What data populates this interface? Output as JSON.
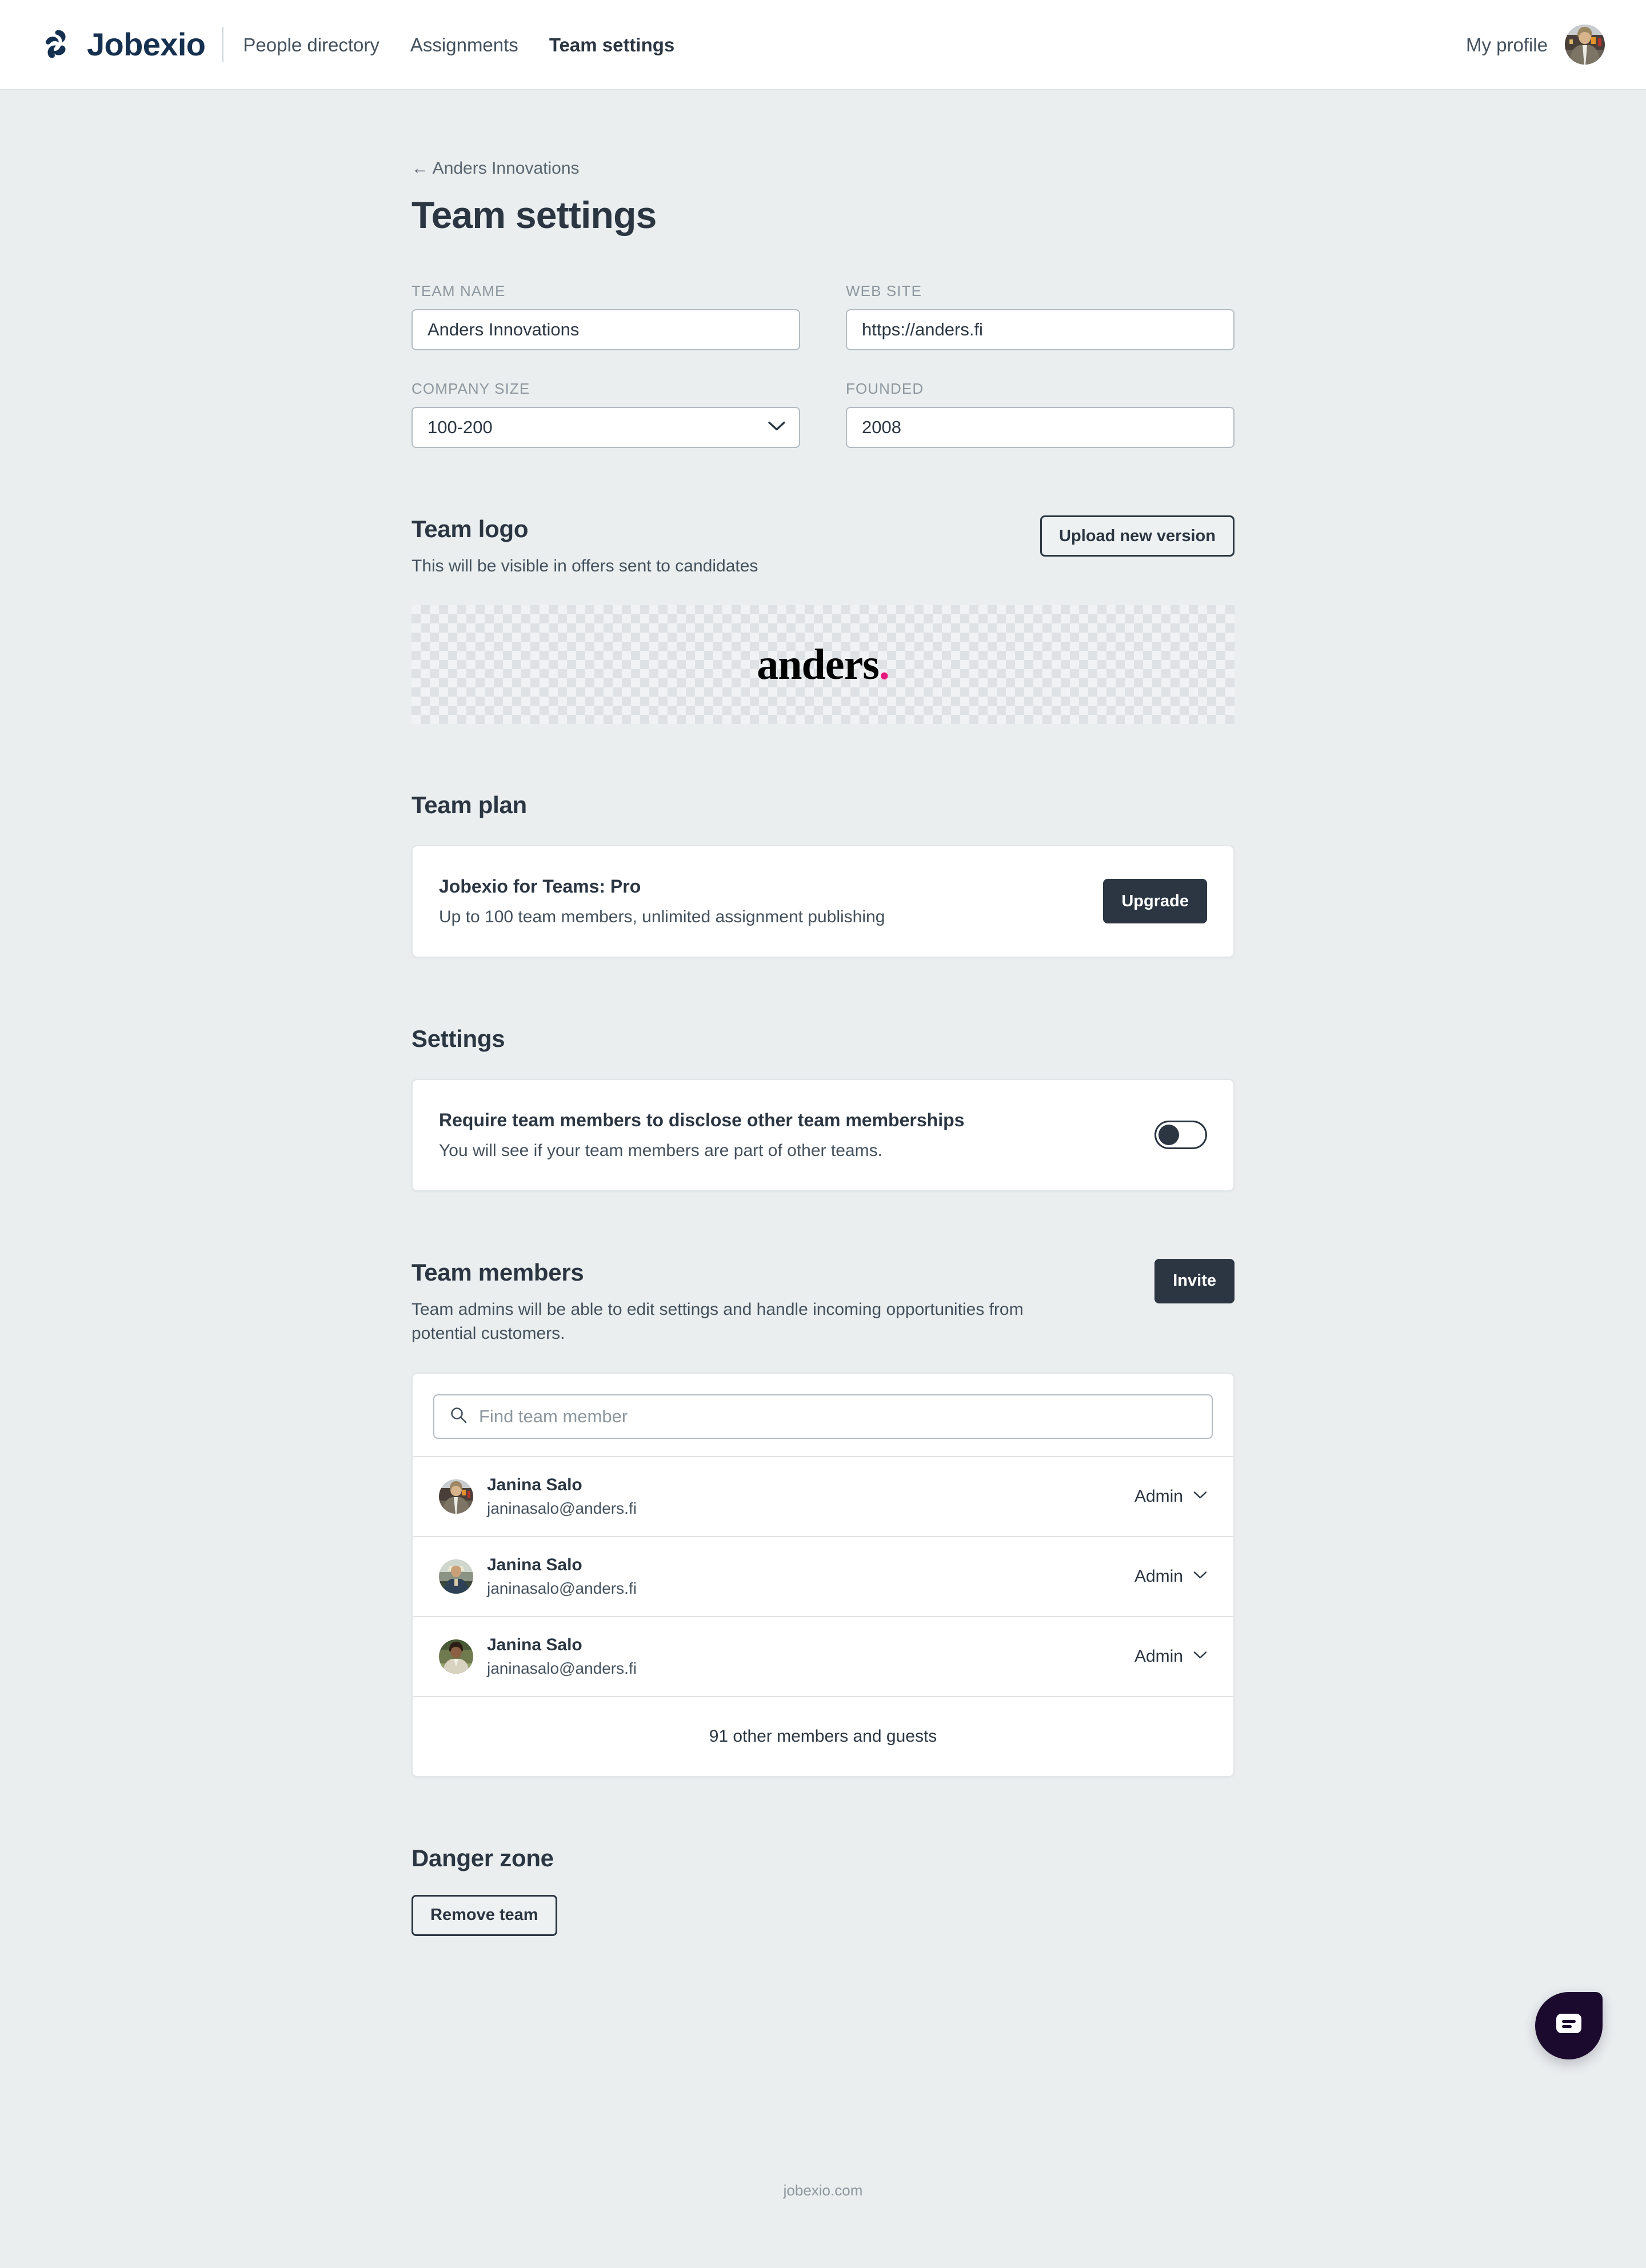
{
  "header": {
    "brand_name": "Jobexio",
    "brand_mark_icon": "jobexio-pinwheel-logo",
    "nav": [
      {
        "label": "People directory",
        "active": false
      },
      {
        "label": "Assignments",
        "active": false
      },
      {
        "label": "Team settings",
        "active": true
      }
    ],
    "profile_label": "My profile",
    "profile_avatar_icon": "user-avatar"
  },
  "breadcrumb": {
    "label": "← Anders Innovations"
  },
  "page_title": "Team settings",
  "form": {
    "team_name": {
      "label": "TEAM NAME",
      "value": "Anders Innovations"
    },
    "web_site": {
      "label": "WEB SITE",
      "value": "https://anders.fi"
    },
    "company_size": {
      "label": "COMPANY SIZE",
      "value": "100-200",
      "chevron_icon": "chevron-down-icon"
    },
    "founded": {
      "label": "FOUNDED",
      "value": "2008"
    }
  },
  "team_logo": {
    "title": "Team logo",
    "subtitle": "This will be visible in offers sent to candidates",
    "upload_button": "Upload new version",
    "logo_text": "anders",
    "logo_dot": ".",
    "logo_dot_color": "#e8177d"
  },
  "team_plan": {
    "title": "Team plan",
    "plan_name": "Jobexio for Teams: Pro",
    "plan_desc": "Up to 100 team members, unlimited assignment publishing",
    "upgrade_button": "Upgrade"
  },
  "settings": {
    "title": "Settings",
    "item_title": "Require team members to disclose other team memberships",
    "item_desc": "You will see if your team members are part of other teams.",
    "toggle_state": "off"
  },
  "team_members": {
    "title": "Team members",
    "subtitle": "Team admins will be able to edit settings and handle incoming opportunities from potential customers.",
    "invite_button": "Invite",
    "search_placeholder": "Find team member",
    "search_value": "",
    "search_icon": "search-icon",
    "members": [
      {
        "name": "Janina Salo",
        "email": "janinasalo@anders.fi",
        "role": "Admin",
        "avatar_icon": "user-avatar"
      },
      {
        "name": "Janina Salo",
        "email": "janinasalo@anders.fi",
        "role": "Admin",
        "avatar_icon": "user-avatar"
      },
      {
        "name": "Janina Salo",
        "email": "janinasalo@anders.fi",
        "role": "Admin",
        "avatar_icon": "user-avatar"
      }
    ],
    "more_members": "91 other members and guests"
  },
  "danger_zone": {
    "title": "Danger zone",
    "remove_button": "Remove team"
  },
  "footer": {
    "link": "jobexio.com"
  },
  "chat": {
    "icon": "chat-bubble-icon",
    "color": "#1b0a2e"
  },
  "colors": {
    "page_bg": "#eaeeef",
    "text_dark": "#2b3642",
    "text_muted": "#44515c",
    "label_muted": "#8d979e",
    "brand_navy": "#163050",
    "accent_pink": "#e8177d"
  }
}
